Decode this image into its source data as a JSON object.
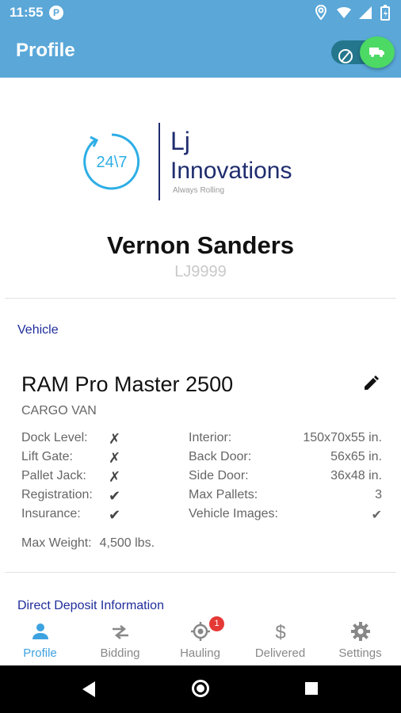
{
  "status_bar": {
    "time": "11:55",
    "app_icon": "P"
  },
  "app_bar": {
    "title": "Profile",
    "toggle_state": "on"
  },
  "logo": {
    "clock_text": "24\\7",
    "line1": "Lj",
    "line2": "Innovations",
    "tagline": "Always Rolling"
  },
  "driver": {
    "name": "Vernon Sanders",
    "id": "LJ9999"
  },
  "vehicle_section": {
    "heading": "Vehicle",
    "title": "RAM Pro Master 2500",
    "subtitle": "CARGO VAN",
    "left_specs": [
      {
        "label": "Dock Level:",
        "value": "✗"
      },
      {
        "label": "Lift Gate:",
        "value": "✗"
      },
      {
        "label": "Pallet Jack:",
        "value": "✗"
      },
      {
        "label": "Registration:",
        "value": "✔"
      },
      {
        "label": "Insurance:",
        "value": "✔"
      }
    ],
    "right_specs": [
      {
        "label": "Interior:",
        "value": "150x70x55 in."
      },
      {
        "label": "Back Door:",
        "value": "56x65 in."
      },
      {
        "label": "Side Door:",
        "value": "36x48 in."
      },
      {
        "label": "Max Pallets:",
        "value": "3"
      },
      {
        "label": "Vehicle Images:",
        "value": "✔"
      }
    ],
    "max_weight_label": "Max Weight:",
    "max_weight_value": "4,500 lbs."
  },
  "deposit_section": {
    "heading": "Direct Deposit Information"
  },
  "bottom_nav": {
    "items": [
      {
        "label": "Profile",
        "icon": "person-icon",
        "active": true
      },
      {
        "label": "Bidding",
        "icon": "swap-arrows-icon",
        "active": false
      },
      {
        "label": "Hauling",
        "icon": "crosshair-icon",
        "active": false,
        "badge": "1"
      },
      {
        "label": "Delivered",
        "icon": "dollar-icon",
        "active": false
      },
      {
        "label": "Settings",
        "icon": "gear-icon",
        "active": false
      }
    ]
  },
  "colors": {
    "primary": "#5aa7d8",
    "accent_green": "#4cd964",
    "section_heading": "#1f2d9a",
    "active_nav": "#3da2e0",
    "badge": "#e53935"
  }
}
